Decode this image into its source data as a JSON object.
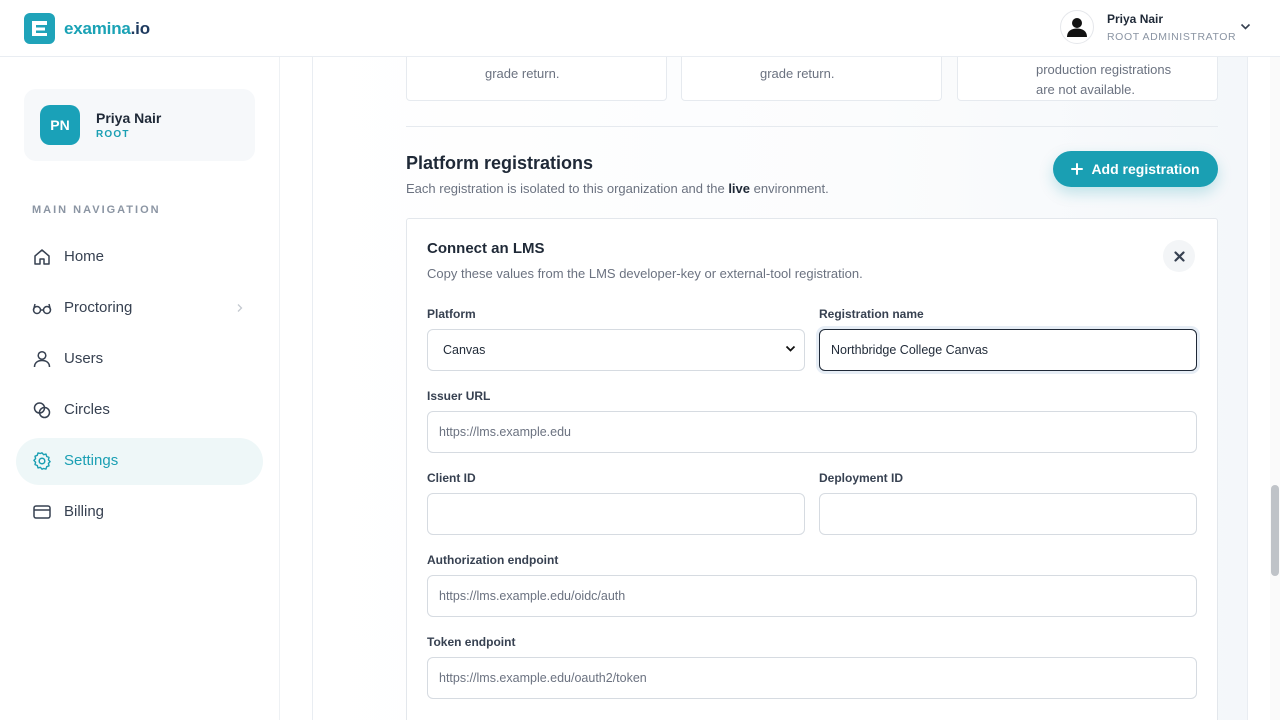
{
  "brand": {
    "name_part1": "examina",
    "name_part2": ".io"
  },
  "header": {
    "user_name": "Priya Nair",
    "user_role": "ROOT ADMINISTRATOR"
  },
  "sidebar": {
    "profile": {
      "initials": "PN",
      "name": "Priya Nair",
      "role": "ROOT"
    },
    "nav_heading": "MAIN NAVIGATION",
    "items": [
      {
        "label": "Home",
        "icon": "home-icon"
      },
      {
        "label": "Proctoring",
        "icon": "glasses-icon"
      },
      {
        "label": "Users",
        "icon": "user-icon"
      },
      {
        "label": "Circles",
        "icon": "circles-icon"
      },
      {
        "label": "Settings",
        "icon": "gear-icon",
        "active": true
      },
      {
        "label": "Billing",
        "icon": "card-icon"
      }
    ]
  },
  "cards": [
    {
      "lines": [
        "grade return."
      ]
    },
    {
      "lines": [
        "grade return."
      ]
    },
    {
      "lines": [
        "production registrations",
        "are not available."
      ]
    }
  ],
  "section": {
    "title": "Platform registrations",
    "desc_prefix": "Each registration is isolated to this organization and the ",
    "desc_bold": "live",
    "desc_suffix": " environment.",
    "add_button": "Add registration"
  },
  "lms_form": {
    "title": "Connect an LMS",
    "desc": "Copy these values from the LMS developer-key or external-tool registration.",
    "platform_label": "Platform",
    "platform_value": "Canvas",
    "registration_name_label": "Registration name",
    "registration_name_value": "Northbridge College Canvas",
    "issuer_label": "Issuer URL",
    "issuer_placeholder": "https://lms.example.edu",
    "client_id_label": "Client ID",
    "deployment_id_label": "Deployment ID",
    "auth_label": "Authorization endpoint",
    "auth_placeholder": "https://lms.example.edu/oidc/auth",
    "token_label": "Token endpoint",
    "token_placeholder": "https://lms.example.edu/oauth2/token"
  },
  "colors": {
    "accent": "#1a9fb3",
    "navy": "#1e3a5f"
  }
}
